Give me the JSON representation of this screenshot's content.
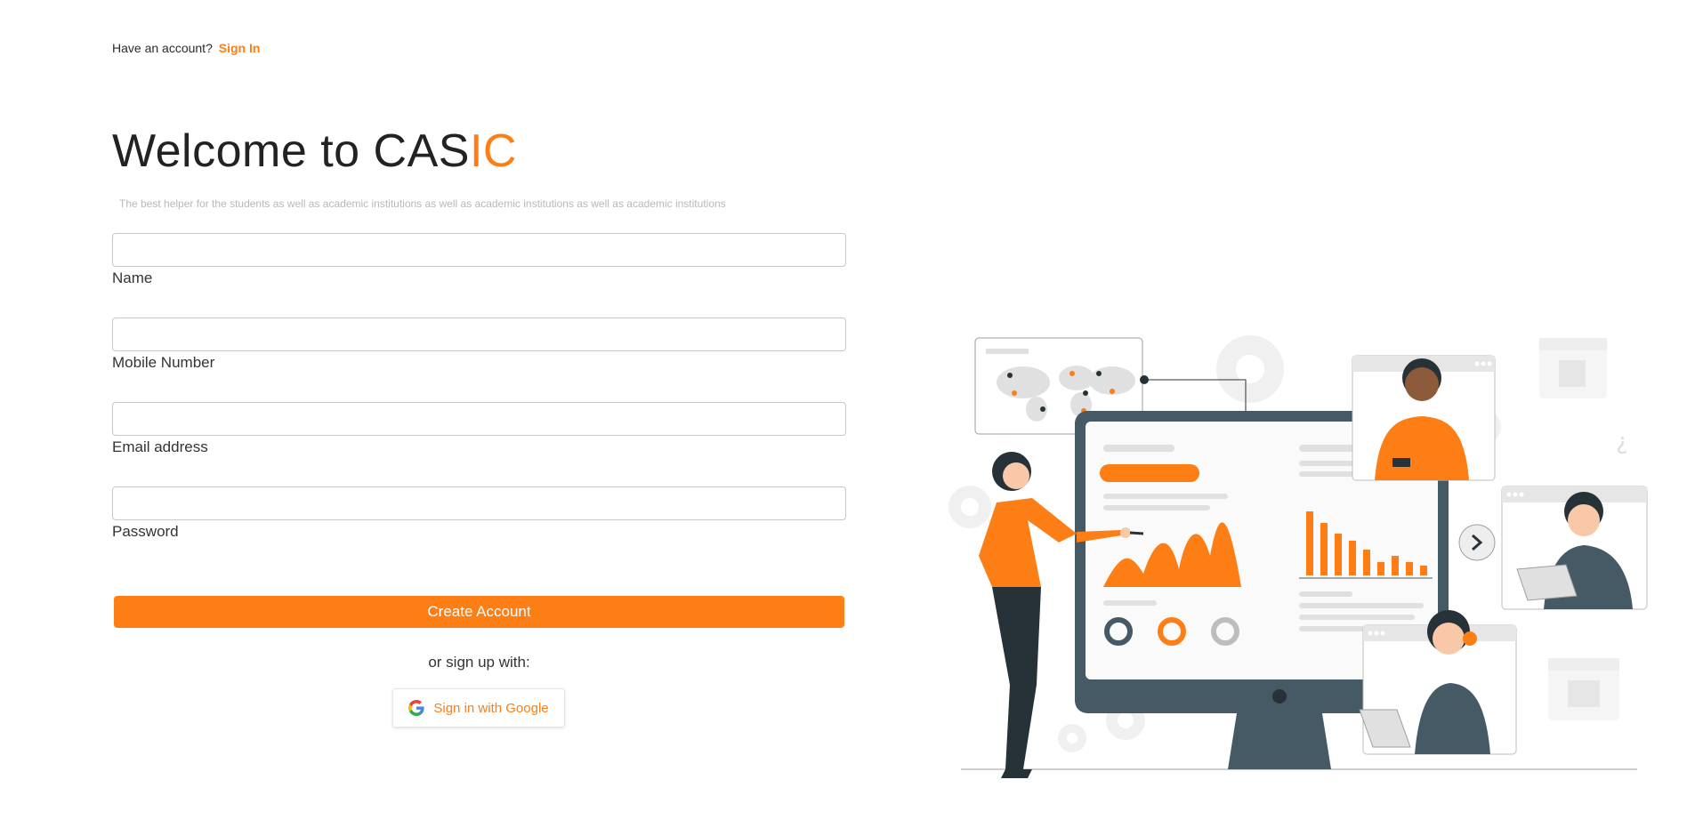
{
  "header": {
    "account_prompt": "Have an account?",
    "sign_in_link": "Sign In"
  },
  "hero": {
    "title_prefix": "Welcome to CAS",
    "title_accent": "IC",
    "subtitle": "The best helper for the students as well as academic institutions as well as academic institutions as well as academic institutions"
  },
  "form": {
    "fields": [
      {
        "label": "Name",
        "value": "",
        "placeholder": ""
      },
      {
        "label": "Mobile Number",
        "value": "",
        "placeholder": ""
      },
      {
        "label": "Email address",
        "value": "",
        "placeholder": ""
      },
      {
        "label": "Password",
        "value": "",
        "placeholder": ""
      }
    ],
    "submit_label": "Create Account",
    "alt_text": "or sign up with:",
    "google_label": "Sign in with Google"
  },
  "theme": {
    "accent": "#fd7e14",
    "dark": "#263238",
    "monitor": "#455a64",
    "icon_google": "google-g-icon"
  }
}
